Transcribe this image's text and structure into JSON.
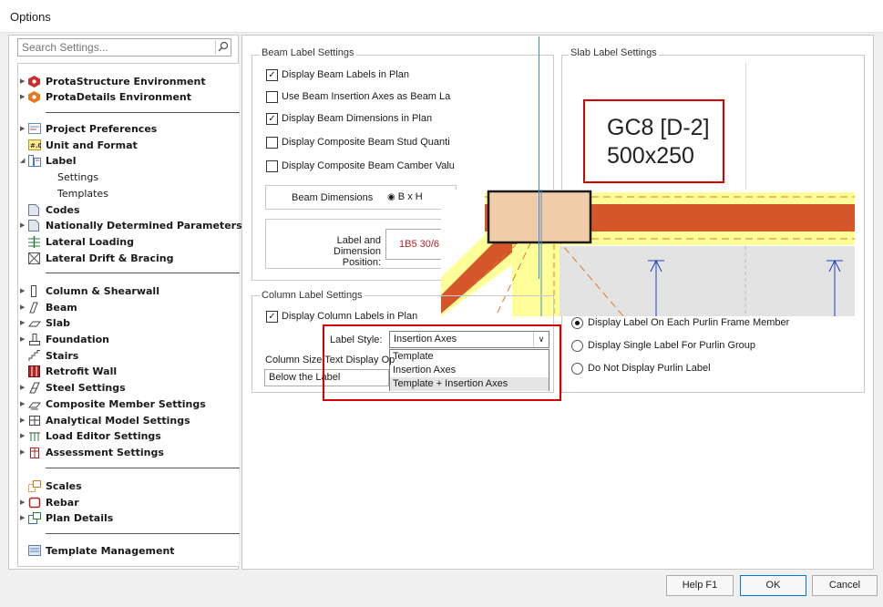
{
  "window": {
    "title": "Options"
  },
  "search": {
    "placeholder": "Search Settings..."
  },
  "tree": {
    "protastructure": "ProtaStructure Environment",
    "protadetails": "ProtaDetails Environment",
    "project_prefs": "Project Preferences",
    "unit_format": "Unit and Format",
    "label": "Label",
    "label_settings": "Settings",
    "label_templates": "Templates",
    "codes": "Codes",
    "ndp": "Nationally Determined Parameters...",
    "lateral_loading": "Lateral Loading",
    "lateral_drift": "Lateral Drift & Bracing",
    "column_shearwall": "Column & Shearwall",
    "beam": "Beam",
    "slab": "Slab",
    "foundation": "Foundation",
    "stairs": "Stairs",
    "retrofit": "Retrofit Wall",
    "steel": "Steel Settings",
    "composite": "Composite Member Settings",
    "analytical": "Analytical Model Settings",
    "load_editor": "Load Editor Settings",
    "assessment": "Assessment Settings",
    "scales": "Scales",
    "rebar": "Rebar",
    "plan_details": "Plan Details",
    "template_mgmt": "Template Management"
  },
  "beam_label": {
    "title": "Beam Label Settings",
    "display_labels": "Display Beam Labels in Plan",
    "use_insertion": "Use Beam Insertion Axes as Beam La",
    "display_dims": "Display Beam Dimensions in Plan",
    "display_stud": "Display Composite Beam Stud Quanti",
    "display_camber": "Display Composite Beam Camber Valu",
    "beam_dims_label": "Beam Dimensions",
    "beam_dims_option": "B x H",
    "label_dim_pos_1": "Label and Dimension",
    "label_dim_pos_2": "Position:",
    "label_preview": "1B5 30/6"
  },
  "slab_label": {
    "title": "Slab Label Settings"
  },
  "preview": {
    "label_line1": "GC8 [D-2]",
    "label_line2": "500x250"
  },
  "column_label": {
    "title": "Column Label Settings",
    "display_labels": "Display Column Labels in Plan",
    "label_style_label": "Label Style:",
    "label_style_value": "Insertion Axes",
    "size_text_label": "Column Size Text Display Op",
    "size_text_value": "Below the Label",
    "options": [
      "Template",
      "Insertion Axes",
      "Template + Insertion Axes"
    ]
  },
  "purlin": {
    "opt1": "Display Label On Each Purlin Frame Member",
    "opt2": "Display Single Label For Purlin Group",
    "opt3": "Do Not Display Purlin Label"
  },
  "buttons": {
    "help": "Help  F1",
    "ok": "OK",
    "cancel": "Cancel"
  },
  "colors": {
    "accent": "#0078d7",
    "highlight": "#d60000",
    "beam_fill": "#ffff99",
    "beam_stripe": "#d4562a"
  }
}
